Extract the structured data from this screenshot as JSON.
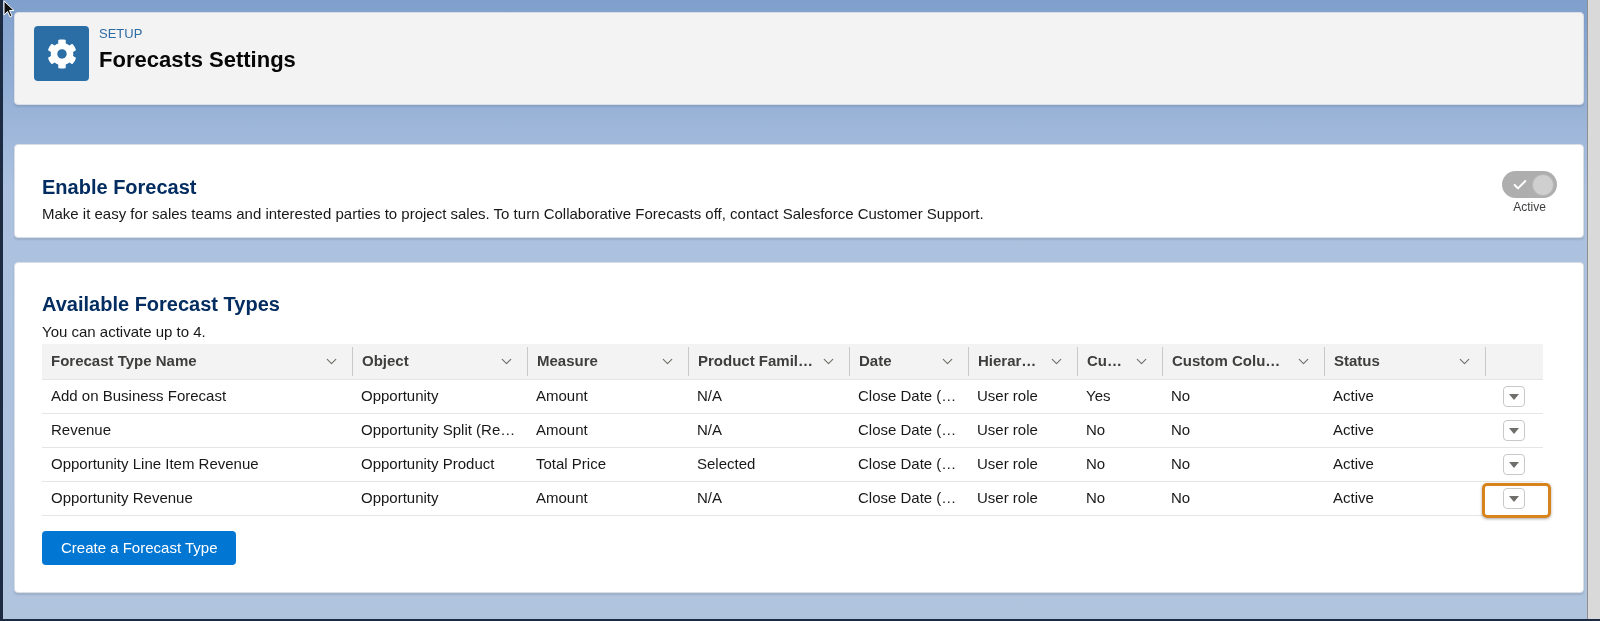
{
  "header": {
    "eyebrow": "SETUP",
    "title": "Forecasts Settings"
  },
  "enable_forecast": {
    "title": "Enable Forecast",
    "description": "Make it easy for sales teams and interested parties to project sales. To turn Collaborative Forecasts off, contact Salesforce Customer Support.",
    "toggle": {
      "checked": true,
      "disabled": true,
      "label": "Active"
    }
  },
  "forecast_types": {
    "title": "Available Forecast Types",
    "subtitle": "You can activate up to 4.",
    "table": {
      "columns": [
        "Forecast Type Name",
        "Object",
        "Measure",
        "Product Famil…",
        "Date",
        "Hierar…",
        "Cu…",
        "Custom Colu…",
        "Status"
      ],
      "rows": [
        {
          "cells": [
            "Add on Business Forecast",
            "Opportunity",
            "Amount",
            "N/A",
            "Close Date (…",
            "User role",
            "Yes",
            "No",
            "Active"
          ],
          "highlighted": false
        },
        {
          "cells": [
            "Revenue",
            "Opportunity Split (Re…",
            "Amount",
            "N/A",
            "Close Date (…",
            "User role",
            "No",
            "No",
            "Active"
          ],
          "highlighted": false
        },
        {
          "cells": [
            "Opportunity Line Item Revenue",
            "Opportunity Product",
            "Total Price",
            "Selected",
            "Close Date (…",
            "User role",
            "No",
            "No",
            "Active"
          ],
          "highlighted": false
        },
        {
          "cells": [
            "Opportunity Revenue",
            "Opportunity",
            "Amount",
            "N/A",
            "Close Date (…",
            "User role",
            "No",
            "No",
            "Active"
          ],
          "highlighted": true
        }
      ]
    },
    "create_button": "Create a Forecast Type"
  }
}
